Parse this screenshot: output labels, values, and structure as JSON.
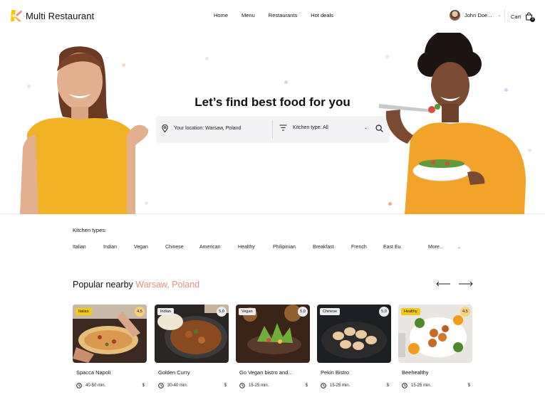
{
  "brand": {
    "name": "Multi Restaurant"
  },
  "nav": [
    "Home",
    "Menu",
    "Restaurants",
    "Hot deals"
  ],
  "user": {
    "name": "John Doe..."
  },
  "cart": {
    "label": "Cart",
    "count": "3"
  },
  "hero": {
    "title": "Let’s find best food for you",
    "location": "Your location: Warsaw, Poland",
    "kitchen_type": "Kitchen type: All"
  },
  "kitchen_types": {
    "title": "Kitchen types:",
    "items": [
      "Italian",
      "Indian",
      "Vegan",
      "Chinese",
      "American",
      "Healthy",
      "Philipinian",
      "Breakfast",
      "French",
      "East Eu"
    ],
    "more": "More..."
  },
  "popular": {
    "title": "Popular nearby",
    "location": "Warsaw, Poland",
    "cards": [
      {
        "tag": "Italian",
        "rating": "4,5",
        "name": "Spacca Napoli",
        "time": "40-50 min.",
        "price": "$"
      },
      {
        "tag": "Indian",
        "rating": "5,0",
        "name": "Golden Curry",
        "time": "30-40 min.",
        "price": "$"
      },
      {
        "tag": "Vegan",
        "rating": "5,0",
        "name": "Go Vegan bistro and...",
        "time": "15-25 min.",
        "price": "$"
      },
      {
        "tag": "Chinese",
        "rating": "5,0",
        "name": "Pekin Bistro",
        "time": "15-25 min.",
        "price": "$"
      },
      {
        "tag": "Healthy",
        "rating": "4,5",
        "name": "Beehealthy",
        "time": "15-25 min.",
        "price": "$"
      }
    ]
  },
  "colors": {
    "accent": "#e8917d",
    "tag_yellow": "#f6c90e",
    "searchbar": "#f3f3f5"
  }
}
